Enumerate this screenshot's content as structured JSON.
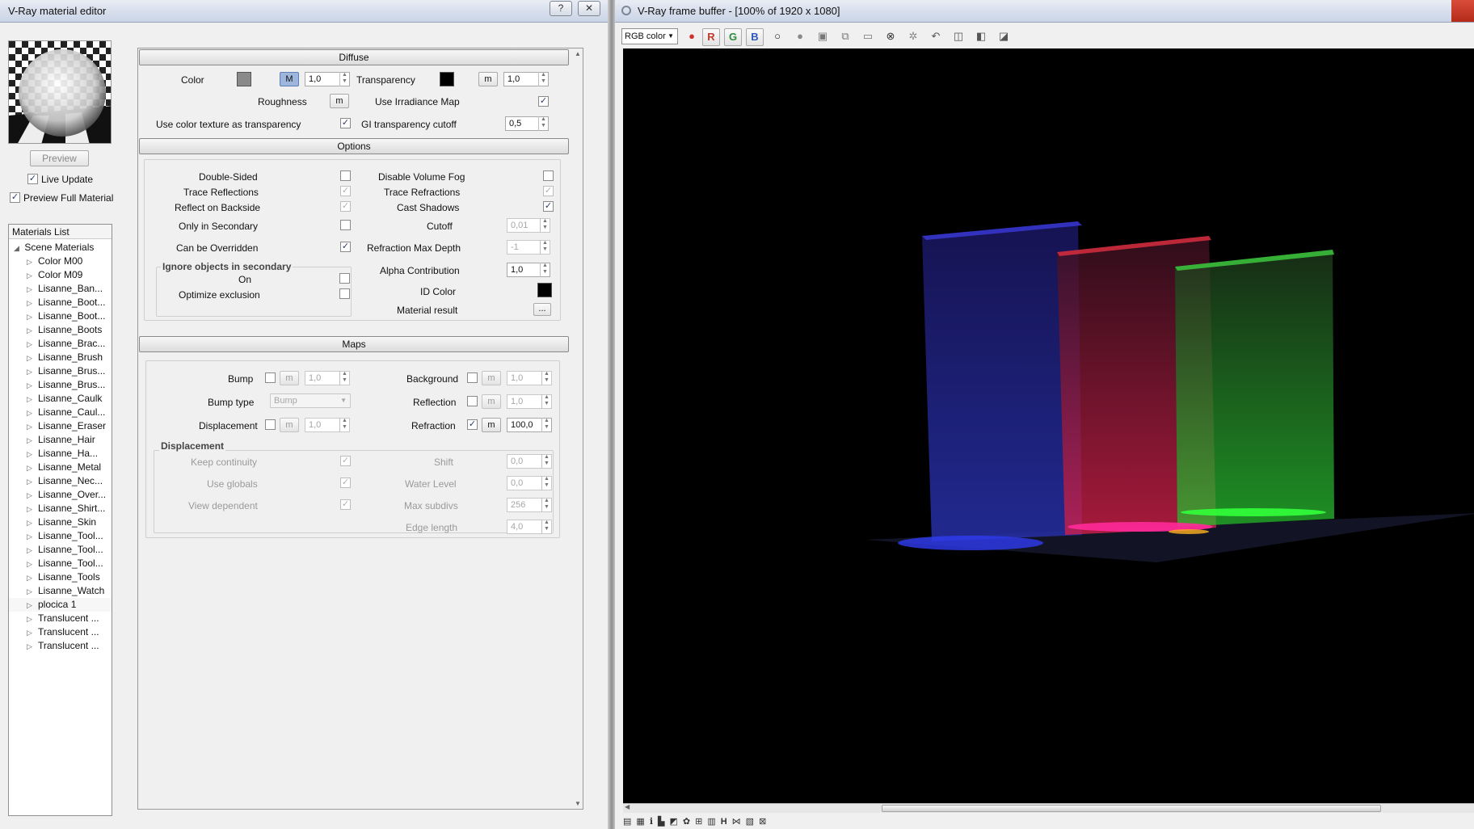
{
  "editor": {
    "title": "V-Ray material editor",
    "help_label": "?",
    "close_label": "✕",
    "preview_label": "Preview",
    "live_update_label": "Live Update",
    "live_update_checked": true,
    "preview_full_label": "Preview Full Material",
    "preview_full_checked": true,
    "materials_list": {
      "header": "Materials List",
      "root": "Scene Materials",
      "items": [
        "Color M00",
        "Color M09",
        "Lisanne_Ban...",
        "Lisanne_Boot...",
        "Lisanne_Boot...",
        "Lisanne_Boots",
        "Lisanne_Brac...",
        "Lisanne_Brush",
        "Lisanne_Brus...",
        "Lisanne_Brus...",
        "Lisanne_Caulk",
        "Lisanne_Caul...",
        "Lisanne_Eraser",
        "Lisanne_Hair",
        "Lisanne_Ha...",
        "Lisanne_Metal",
        "Lisanne_Nec...",
        "Lisanne_Over...",
        "Lisanne_Shirt...",
        "Lisanne_Skin",
        "Lisanne_Tool...",
        "Lisanne_Tool...",
        "Lisanne_Tool...",
        "Lisanne_Tools",
        "Lisanne_Watch",
        "plocica 1",
        "Translucent ...",
        "Translucent ...",
        "Translucent ..."
      ],
      "selected_index": 25
    },
    "diffuse": {
      "header": "Diffuse",
      "color_label": "Color",
      "color_swatch": "#8a8a8a",
      "color_m": "M",
      "color_value": "1,0",
      "transparency_label": "Transparency",
      "transparency_swatch": "#000000",
      "transparency_m": "m",
      "transparency_value": "1,0",
      "roughness_label": "Roughness",
      "roughness_m": "m",
      "use_irradiance_label": "Use Irradiance Map",
      "use_color_tex_label": "Use color texture as transparency",
      "gi_cutoff_label": "GI transparency cutoff",
      "gi_cutoff_value": "0,5"
    },
    "options": {
      "header": "Options",
      "double_sided": "Double-Sided",
      "trace_reflections": "Trace Reflections",
      "reflect_backside": "Reflect on Backside",
      "only_secondary": "Only in Secondary",
      "can_be_overridden": "Can be Overridden",
      "ignore_group": "Ignore objects in secondary",
      "on_label": "On",
      "optimize_exclusion": "Optimize exclusion",
      "disable_volume_fog": "Disable Volume Fog",
      "trace_refractions": "Trace Refractions",
      "cast_shadows": "Cast Shadows",
      "cutoff_label": "Cutoff",
      "cutoff_value": "0,01",
      "refr_max_depth_label": "Refraction Max Depth",
      "refr_max_depth_value": "-1",
      "alpha_contrib_label": "Alpha Contribution",
      "alpha_contrib_value": "1,0",
      "id_color_label": "ID Color",
      "id_color": "#000000",
      "material_result_label": "Material result",
      "material_result_btn": "..."
    },
    "maps": {
      "header": "Maps",
      "bump_label": "Bump",
      "bump_m": "m",
      "bump_value": "1,0",
      "bump_type_label": "Bump type",
      "bump_type_value": "Bump",
      "displacement_label": "Displacement",
      "displacement_m": "m",
      "displacement_value": "1,0",
      "background_label": "Background",
      "background_m": "m",
      "background_value": "1,0",
      "reflection_label": "Reflection",
      "reflection_m": "m",
      "reflection_value": "1,0",
      "refraction_label": "Refraction",
      "refraction_m": "m",
      "refraction_value": "100,0",
      "disp_group": "Displacement",
      "keep_continuity": "Keep continuity",
      "use_globals": "Use globals",
      "view_dependent": "View dependent",
      "shift_label": "Shift",
      "shift_value": "0,0",
      "water_level_label": "Water Level",
      "water_level_value": "0,0",
      "max_subdivs_label": "Max subdivs",
      "max_subdivs_value": "256",
      "edge_length_label": "Edge length",
      "edge_length_value": "4,0"
    }
  },
  "framebuffer": {
    "title": "V-Ray frame buffer - [100% of 1920 x 1080]",
    "channel": "RGB color",
    "r_label": "R",
    "g_label": "G",
    "b_label": "B",
    "bottom_mark": "H"
  }
}
